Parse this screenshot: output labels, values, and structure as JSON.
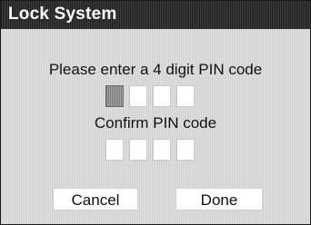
{
  "dialog": {
    "title": "Lock System",
    "enter_prompt": "Please enter a 4 digit PIN code",
    "confirm_prompt": "Confirm PIN code",
    "pin_length": 4,
    "active_box_index": 0,
    "buttons": {
      "cancel_label": "Cancel",
      "done_label": "Done"
    }
  },
  "colors": {
    "title_bar": "#2a2a2a",
    "background": "#d6d6d6",
    "active_box": "#8f8f8f",
    "box": "#ffffff"
  }
}
